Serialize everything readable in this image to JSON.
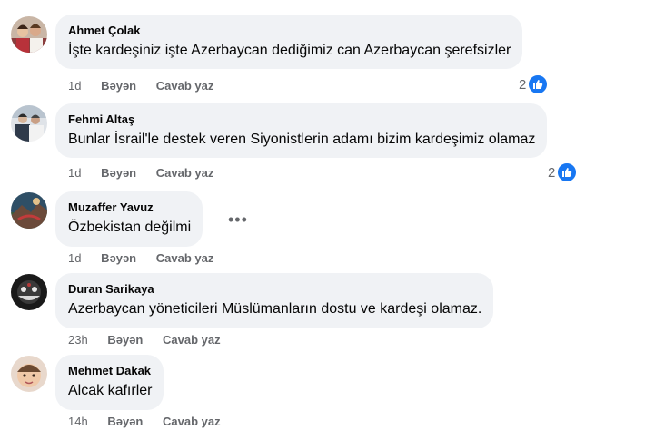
{
  "comments": [
    {
      "author": "Ahmet Çolak",
      "text": "İşte kardeşiniz işte Azerbaycan dediğimiz can Azerbaycan şerefsizler",
      "time": "1d",
      "like_label": "Bəyən",
      "reply_label": "Cavab yaz",
      "reactions": "2",
      "reaction_icon": "thumbs-up-icon"
    },
    {
      "author": "Fehmi Altaş",
      "text": "Bunlar İsrail'le destek veren Siyonistlerin adamı bizim kardeşimiz olamaz",
      "time": "1d",
      "like_label": "Bəyən",
      "reply_label": "Cavab yaz",
      "reactions": "2",
      "reaction_icon": "thumbs-up-icon"
    },
    {
      "author": "Muzaffer Yavuz",
      "text": "Özbekistan değilmi",
      "time": "1d",
      "like_label": "Bəyən",
      "reply_label": "Cavab yaz",
      "more_icon": "more-options-icon"
    },
    {
      "author": "Duran Sarikaya",
      "text": "Azerbaycan yöneticileri Müslümanların dostu ve kardeşi olamaz.",
      "time": "23h",
      "like_label": "Bəyən",
      "reply_label": "Cavab yaz"
    },
    {
      "author": "Mehmet Dakak",
      "text": "Alcak kafırler",
      "time": "14h",
      "like_label": "Bəyən",
      "reply_label": "Cavab yaz"
    }
  ],
  "colors": {
    "bubble_bg": "#f0f2f5",
    "meta_text": "#65676b",
    "like_blue": "#1877f2"
  }
}
